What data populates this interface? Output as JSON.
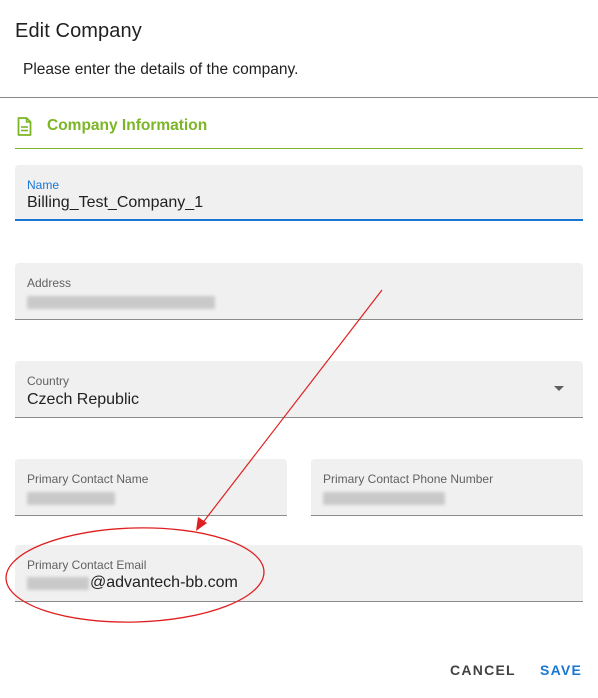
{
  "dialog": {
    "title": "Edit Company",
    "subtitle": "Please enter the details of the company."
  },
  "section": {
    "title": "Company Information",
    "icon": "document-icon",
    "accent_color": "#7cb526"
  },
  "fields": {
    "name": {
      "label": "Name",
      "value": "Billing_Test_Company_1"
    },
    "address": {
      "label": "Address",
      "value_redacted": true
    },
    "country": {
      "label": "Country",
      "value": "Czech Republic"
    },
    "contact_name": {
      "label": "Primary Contact Name",
      "value_redacted": true
    },
    "contact_phone": {
      "label": "Primary Contact Phone Number",
      "value_redacted": true
    },
    "contact_email": {
      "label": "Primary Contact Email",
      "value_suffix": "@advantech-bb.com"
    }
  },
  "actions": {
    "cancel_label": "CANCEL",
    "save_label": "SAVE"
  },
  "colors": {
    "focus": "#1976d2",
    "annotation": "#e02020"
  }
}
